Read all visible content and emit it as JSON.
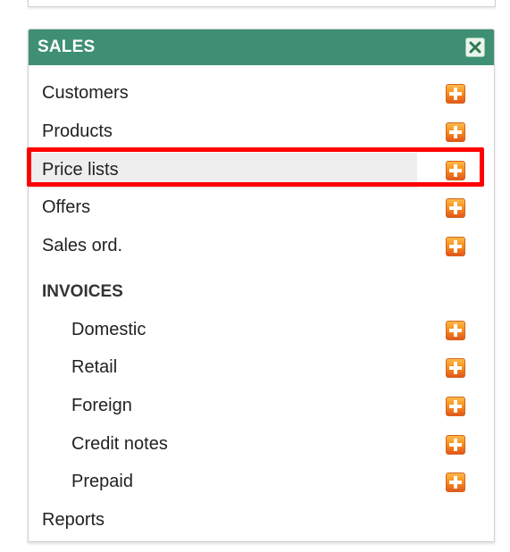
{
  "panel": {
    "title": "SALES"
  },
  "menu": {
    "items": [
      {
        "label": "Customers"
      },
      {
        "label": "Products"
      },
      {
        "label": "Price lists"
      },
      {
        "label": "Offers"
      },
      {
        "label": "Sales ord."
      }
    ],
    "invoices_heading": "INVOICES",
    "invoice_items": [
      {
        "label": "Domestic"
      },
      {
        "label": "Retail"
      },
      {
        "label": "Foreign"
      },
      {
        "label": "Credit notes"
      },
      {
        "label": "Prepaid"
      }
    ],
    "reports_label": "Reports"
  },
  "colors": {
    "header": "#3f8f74",
    "highlight": "#ff0000",
    "add_icon": "#f7931e"
  },
  "icons": {
    "close": "close-icon",
    "add": "plus-icon"
  }
}
